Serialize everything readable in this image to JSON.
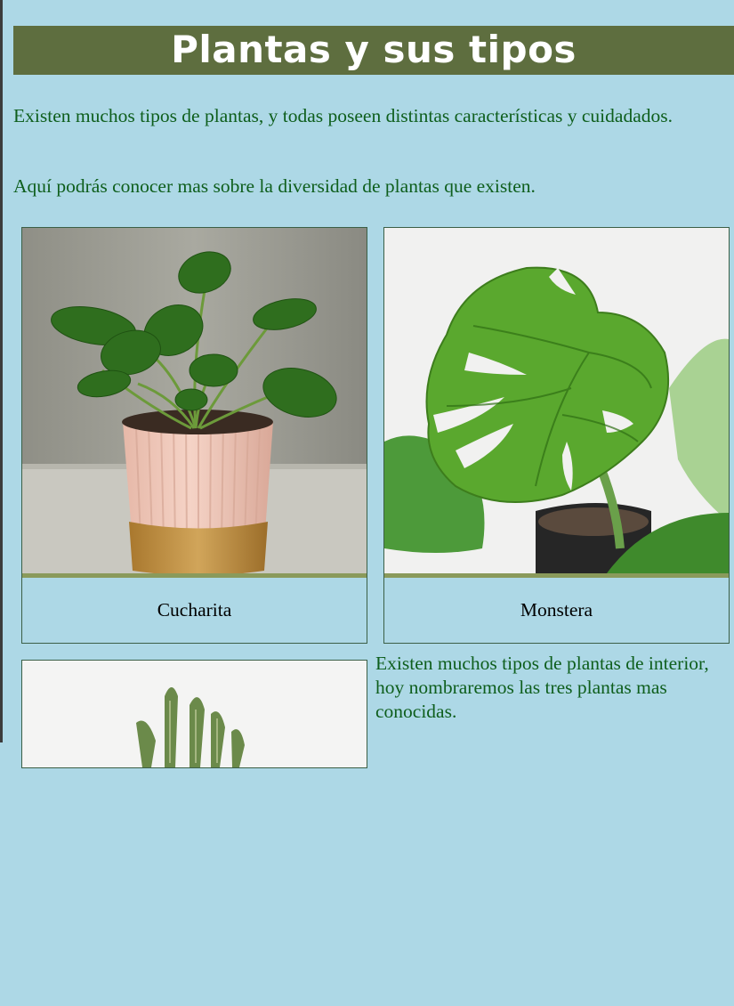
{
  "page": {
    "title": "Plantas y sus tipos",
    "intro_1": "Existen muchos tipos de plantas, y todas poseen distintas características y cuidadados.",
    "intro_2": "Aquí podrás conocer mas sobre la diversidad de plantas que existen.",
    "side_text": "Existen muchos tipos de plantas de interior, hoy nombraremos las tres plantas mas conocidas."
  },
  "cards": [
    {
      "caption": "Cucharita",
      "image": "pilea-plant-in-pink-ribbed-pot"
    },
    {
      "caption": "Monstera",
      "image": "monstera-leaf"
    },
    {
      "caption": "",
      "image": "snake-plant"
    }
  ],
  "colors": {
    "background": "#add8e6",
    "header": "#5e6e3f",
    "text_green": "#0e5e1c",
    "separator": "#8a9a5b"
  }
}
